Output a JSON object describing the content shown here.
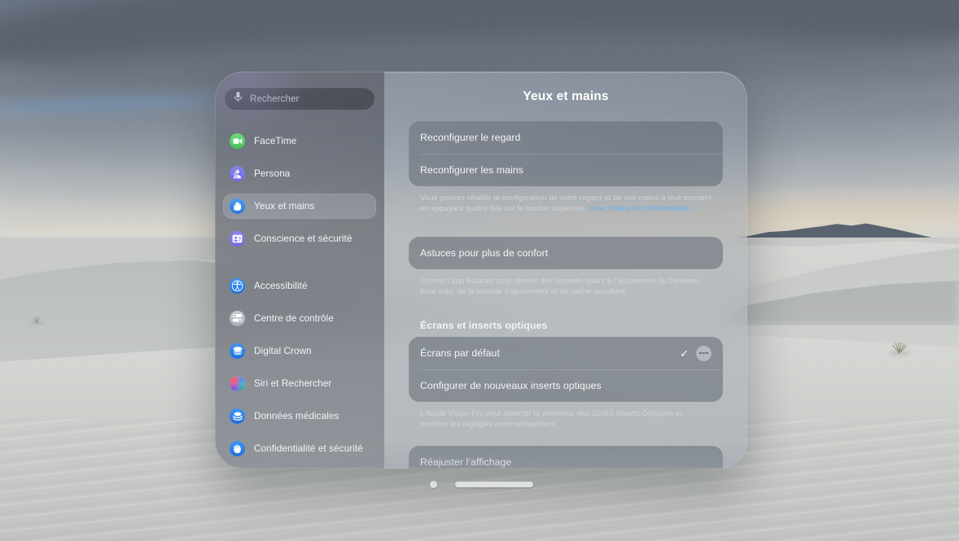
{
  "window": {
    "search": {
      "placeholder": "Rechercher",
      "icon": "microphone-icon"
    },
    "sidebar": {
      "items": [
        {
          "label": "FaceTime",
          "icon": "facetime-icon",
          "selected": false
        },
        {
          "label": "Persona",
          "icon": "persona-icon",
          "selected": false
        },
        {
          "label": "Yeux et mains",
          "icon": "eyes-hands-icon",
          "selected": true
        },
        {
          "label": "Conscience et sécurité",
          "icon": "awareness-safety-icon",
          "selected": false
        },
        {
          "label": "Accessibilité",
          "icon": "accessibility-icon",
          "selected": false,
          "gap_before": true
        },
        {
          "label": "Centre de contrôle",
          "icon": "control-center-icon",
          "selected": false
        },
        {
          "label": "Digital Crown",
          "icon": "digital-crown-icon",
          "selected": false
        },
        {
          "label": "Siri et Rechercher",
          "icon": "siri-icon",
          "selected": false
        },
        {
          "label": "Données médicales",
          "icon": "health-icon",
          "selected": false
        },
        {
          "label": "Confidentialité et sécurité",
          "icon": "privacy-icon",
          "selected": false
        }
      ]
    },
    "detail": {
      "title": "Yeux et mains",
      "group1": {
        "rows": [
          {
            "label": "Reconfigurer le regard"
          },
          {
            "label": "Reconfigurer les mains"
          }
        ],
        "footnote_text": "Vous pouvez rétablir la configuration de votre regard et de vos mains à tout moment en appuyant quatre fois sur le bouton supérieur. ",
        "footnote_link": "Yeux, mains et confidentialité…"
      },
      "group2": {
        "rows": [
          {
            "label": "Astuces pour plus de confort"
          }
        ],
        "footnote_text": "Ouvrez l’app Astuces pour obtenir des conseils quant à l’ajustement du bandeau tissé solo, de la molette d’ajustement et du cache occultant."
      },
      "section2_title": "Écrans et inserts optiques",
      "group3": {
        "rows": [
          {
            "label": "Écrans par défaut",
            "checked": true,
            "has_more": true,
            "check_glyph": "✓"
          },
          {
            "label": "Configurer de nouveaux inserts optiques"
          }
        ],
        "footnote_text": "L’Apple Vision Pro peut détecter la présence des ZEISS Inserts Optiques et modifier les réglages automatiquement."
      },
      "group4": {
        "rows": [
          {
            "label": "Réajuster l’affichage"
          }
        ]
      }
    },
    "chrome": {
      "close_label": "close-window",
      "grab_label": "window-grab-bar"
    }
  },
  "colors": {
    "accent_link": "#63b3f5",
    "selected_row": "#bec4d0",
    "window_glass": "#969eaa"
  }
}
